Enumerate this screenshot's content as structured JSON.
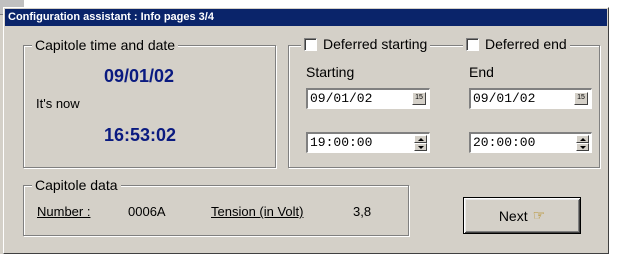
{
  "window": {
    "title": "Configuration assistant : Info pages 3/4"
  },
  "time_group": {
    "legend": "Capitole time and date",
    "date_value": "09/01/02",
    "its_now_label": "It's now",
    "time_value": "16:53:02"
  },
  "deferred": {
    "start_checkbox_label": "Deferred starting",
    "end_checkbox_label": "Deferred end",
    "starting_label": "Starting",
    "end_label": "End",
    "start_date": "09/01/02",
    "end_date": "09/01/02",
    "start_time": "19:00:00",
    "end_time": "20:00:00",
    "calendar_glyph": "15"
  },
  "data_group": {
    "legend": "Capitole data",
    "number_label": "Number :",
    "number_value": "0006A",
    "tension_label": "Tension (in Volt)",
    "tension_value": "3,8"
  },
  "buttons": {
    "next_label": "Next",
    "next_icon": "hand-pointer-icon"
  },
  "colors": {
    "titlebar": "#0a246a",
    "dialog_face": "#d4d0c8",
    "value_blue": "#0a1a80"
  }
}
